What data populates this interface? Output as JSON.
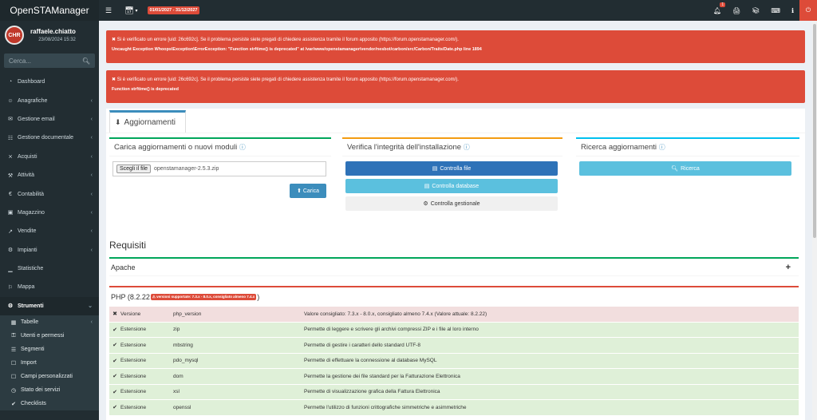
{
  "app": {
    "logo": "OpenSTAManager",
    "user_name": "raffaele.chiatto",
    "user_date": "23/08/2024 15:32",
    "avatar_text": "CHR"
  },
  "search": {
    "placeholder": "Cerca..."
  },
  "topbar": {
    "date_range": "01/01/2027 - 31/12/2027",
    "notifications_count": "1"
  },
  "sidebar": {
    "items": [
      {
        "label": "Dashboard",
        "icon": "dashboard-icon",
        "chevron": false
      },
      {
        "label": "Anagrafiche",
        "icon": "users-icon",
        "chevron": true
      },
      {
        "label": "Gestione email",
        "icon": "envelope-icon",
        "chevron": true
      },
      {
        "label": "Gestione documentale",
        "icon": "files-icon",
        "chevron": true
      },
      {
        "label": "Acquisti",
        "icon": "cart-icon",
        "chevron": true
      },
      {
        "label": "Attività",
        "icon": "wrench-icon",
        "chevron": true
      },
      {
        "label": "Contabilità",
        "icon": "euro-icon",
        "chevron": true
      },
      {
        "label": "Magazzino",
        "icon": "truck-icon",
        "chevron": true
      },
      {
        "label": "Vendite",
        "icon": "chart-line-icon",
        "chevron": true
      },
      {
        "label": "Impianti",
        "icon": "gears-icon",
        "chevron": true
      },
      {
        "label": "Statistiche",
        "icon": "bar-chart-icon",
        "chevron": false
      },
      {
        "label": "Mappa",
        "icon": "map-icon",
        "chevron": false
      },
      {
        "label": "Strumenti",
        "icon": "cog-icon",
        "chevron": true
      }
    ],
    "subitems": [
      {
        "label": "Tabelle",
        "chevron": true
      },
      {
        "label": "Utenti e permessi",
        "chevron": false
      },
      {
        "label": "Segmenti",
        "chevron": false
      },
      {
        "label": "Import",
        "chevron": false
      },
      {
        "label": "Campi personalizzati",
        "chevron": false
      },
      {
        "label": "Stato dei servizi",
        "chevron": false
      },
      {
        "label": "Checklists",
        "chevron": false
      }
    ]
  },
  "alerts": [
    {
      "message": "✖ Si è verificato un errore [uid: 26c692c]. Se il problema persiste siete pregati di chiedere assistenza tramite il forum apposito (https://forum.openstamanager.com/).",
      "detail": "Uncaught Exception Whoops\\Exception\\ErrorException: \"Function strftime() is deprecated\" at /var/www/openstamanager/vendor/nesbot/carbon/src/Carbon/Traits/Date.php line 1894"
    },
    {
      "message": "✖ Si è verificato un errore [uid: 26c692c]. Se il problema persiste siete pregati di chiedere assistenza tramite il forum apposito (https://forum.openstamanager.com/).",
      "detail": "Function strftime() is deprecated"
    }
  ],
  "tab": {
    "label": "Aggiornamenti"
  },
  "boxes": {
    "upload": {
      "title": "Carica aggiornamenti o nuovi moduli",
      "file_button": "Scegli il file",
      "file_name": "openstamanager-2.5.3.zip",
      "submit": "Carica"
    },
    "integrity": {
      "title": "Verifica l'integrità dell'installazione",
      "btn_files": "Controlla file",
      "btn_db": "Controlla database",
      "btn_mgmt": "Controlla gestionale"
    },
    "search_updates": {
      "title": "Ricerca aggiornamenti",
      "btn": "Ricerca"
    }
  },
  "requirements": {
    "title": "Requisiti",
    "apache_label": "Apache",
    "php_label_prefix": "PHP (8.2.22",
    "php_label_suffix": ")",
    "php_badge": "⚠ versioni supportate: 7.3.x - 8.0.x, consigliato almeno 7.4.x",
    "colors": {
      "ok": "#dff0d8",
      "error": "#f2dede"
    },
    "rows": [
      {
        "status": "error",
        "type": "Versione",
        "name": "php_version",
        "desc": "Valore consigliato: 7.3.x - 8.0.x, consigliato almeno 7.4.x (Valore attuale: 8.2.22)"
      },
      {
        "status": "ok",
        "type": "Estensione",
        "name": "zip",
        "desc": "Permette di leggere e scrivere gli archivi compressi ZIP e i file al loro interno"
      },
      {
        "status": "ok",
        "type": "Estensione",
        "name": "mbstring",
        "desc": "Permette di gestire i caratteri dello standard UTF-8"
      },
      {
        "status": "ok",
        "type": "Estensione",
        "name": "pdo_mysql",
        "desc": "Permette di effettuare la connessione al database MySQL"
      },
      {
        "status": "ok",
        "type": "Estensione",
        "name": "dom",
        "desc": "Permette la gestione dei file standard per la Fatturazione Elettronica"
      },
      {
        "status": "ok",
        "type": "Estensione",
        "name": "xsl",
        "desc": "Permette di visualizzazione grafica della Fattura Elettronica"
      },
      {
        "status": "ok",
        "type": "Estensione",
        "name": "openssl",
        "desc": "Permette l'utilizzo di funzioni crittografiche simmetriche e asimmetriche"
      }
    ]
  }
}
